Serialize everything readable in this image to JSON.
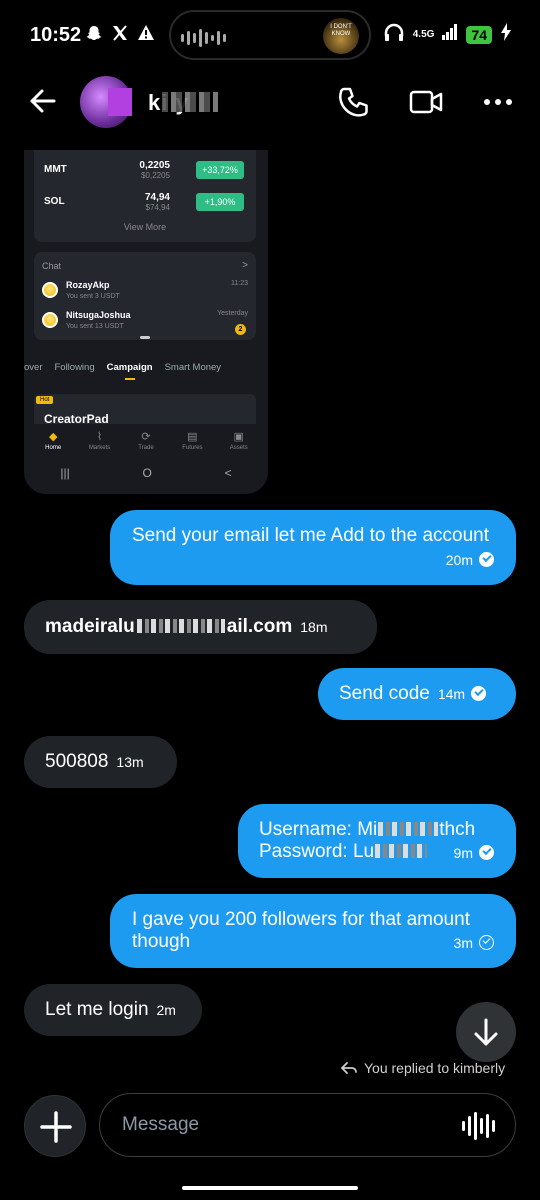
{
  "status_bar": {
    "time": "10:52",
    "left_icons": [
      "snapchat-icon",
      "x-icon",
      "warning-icon"
    ],
    "island_art_text": "I DON'T KNOW",
    "network": "4.5G",
    "battery": "74"
  },
  "header": {
    "contact_name": "ki   y",
    "icons": [
      "back-arrow-icon",
      "phone-icon",
      "video-icon",
      "more-icon"
    ]
  },
  "shared_screenshot": {
    "coins": [
      {
        "name": "MMT",
        "price": "0,2205",
        "price_sub": "$0,2205",
        "change": "+33,72%"
      },
      {
        "name": "SOL",
        "price": "74,94",
        "price_sub": "$74,94",
        "change": "+1,90%"
      }
    ],
    "view_more": "View More",
    "chat_title": "Chat",
    "chats": [
      {
        "name": "RozayAkp",
        "sub": "You sent 3 USDT",
        "time": "11:23",
        "badge": ""
      },
      {
        "name": "NitsugaJoshua",
        "sub": "You sent 13 USDT",
        "time": "Yesterday",
        "badge": "2"
      }
    ],
    "tabs": [
      "over",
      "Following",
      "Campaign",
      "Smart Money"
    ],
    "hot_label": "Hot",
    "promo_title": "CreatorPad",
    "nav": [
      "Home",
      "Markets",
      "Trade",
      "Futures",
      "Assets"
    ],
    "system_nav": [
      "|||",
      "O",
      "<"
    ]
  },
  "messages": [
    {
      "dir": "out",
      "text": "Send your email let me Add to the account",
      "time": "20m",
      "status": "read"
    },
    {
      "dir": "in",
      "text_pre": "madeiralu",
      "text_post": "ail.com",
      "time": "18m"
    },
    {
      "dir": "out",
      "text": "Send code",
      "time": "14m",
      "status": "read"
    },
    {
      "dir": "in",
      "text": "500808",
      "time": "13m"
    },
    {
      "dir": "out",
      "line1_pre": "Username: Mi",
      "line1_post": "thch",
      "line2_pre": "Password: Lu",
      "time": "9m",
      "status": "read"
    },
    {
      "dir": "out",
      "text": "I gave you 200 followers for that amount though",
      "time": "3m",
      "status": "sent"
    },
    {
      "dir": "in",
      "text": "Let me login",
      "time": "2m"
    }
  ],
  "replied_note": "You replied to kimberly",
  "composer": {
    "placeholder": "Message"
  },
  "colors": {
    "outgoing_bubble": "#1d9bf0",
    "incoming_bubble": "#202327",
    "positive_change": "#2ebd85",
    "binance_yellow": "#f0b90b"
  }
}
